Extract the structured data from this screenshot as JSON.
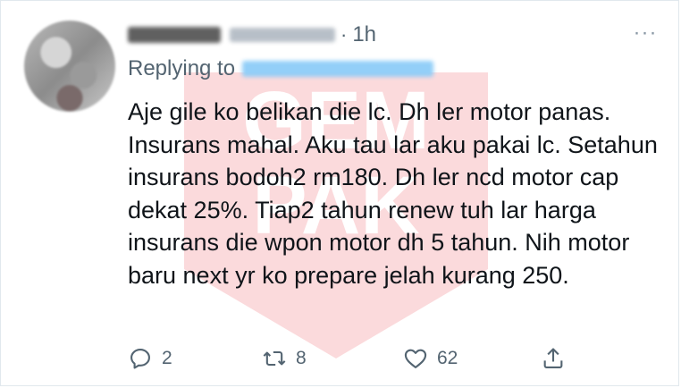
{
  "tweet": {
    "time": "1h",
    "separator": "·",
    "replying_to_prefix": "Replying to",
    "more_label": "···",
    "text": "Aje gile ko belikan die lc. Dh ler motor panas. Insurans mahal. Aku tau lar aku pakai lc. Setahun insurans bodoh2 rm180. Dh ler ncd motor cap dekat 25%. Tiap2 tahun renew tuh lar harga insurans die wpon motor dh 5 tahun. Nih motor baru next yr ko prepare jelah kurang 250."
  },
  "actions": {
    "reply": {
      "icon": "reply-bubble-icon",
      "count": "2"
    },
    "retweet": {
      "icon": "retweet-icon",
      "count": "8"
    },
    "like": {
      "icon": "heart-icon",
      "count": "62"
    },
    "share": {
      "icon": "share-upload-icon"
    }
  },
  "colors": {
    "text": "#0f1419",
    "secondary": "#536471",
    "mention_blue": "#1d9bf0",
    "watermark_red": "#e8202a"
  }
}
